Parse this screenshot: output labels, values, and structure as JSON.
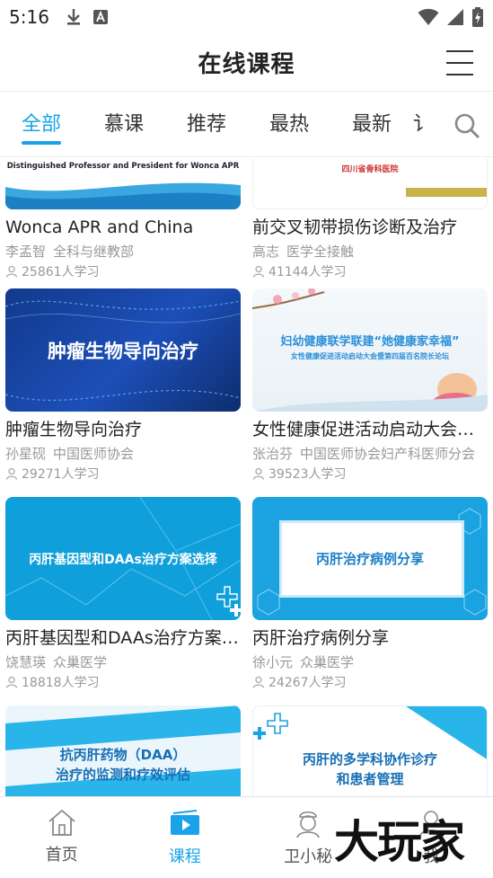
{
  "status_bar": {
    "time": "5:16"
  },
  "header": {
    "title": "在线课程"
  },
  "tabs": [
    {
      "label": "全部",
      "active": true
    },
    {
      "label": "慕课",
      "active": false
    },
    {
      "label": "推荐",
      "active": false
    },
    {
      "label": "最热",
      "active": false
    },
    {
      "label": "最新",
      "active": false
    },
    {
      "label": "讠",
      "active": false
    }
  ],
  "courses": [
    {
      "title": "Wonca APR and China",
      "teacher": "李孟智",
      "org": "全科与继教部",
      "learners": "25861人学习",
      "thumb_lines": [
        "Distinguished Professor and President for  Wonca APR"
      ]
    },
    {
      "title": "前交叉韧带损伤诊断及治疗",
      "teacher": "高志",
      "org": "医学全接触",
      "learners": "41144人学习",
      "thumb_lines": [
        "四川省骨科医院"
      ]
    },
    {
      "title": "肿瘤生物导向治疗",
      "teacher": "孙星砚",
      "org": "中国医师协会",
      "learners": "29271人学习",
      "thumb_lines": [
        "肿瘤生物导向治疗"
      ]
    },
    {
      "title": "女性健康促进活动启动大会暨第四届百名院长论坛",
      "teacher": "张治芬",
      "org": "中国医师协会妇产科医师分会",
      "learners": "39523人学习",
      "thumb_lines": [
        "妇幼健康联学联建“她健康家幸福”",
        "女性健康促进活动启动大会暨第四届百名院长论坛"
      ]
    },
    {
      "title": "丙肝基因型和DAAs治疗方案选择",
      "teacher": "饶慧瑛",
      "org": "众巢医学",
      "learners": "18818人学习",
      "thumb_lines": [
        "丙肝基因型和DAAs治疗方案选择"
      ]
    },
    {
      "title": "丙肝治疗病例分享",
      "teacher": "徐小元",
      "org": "众巢医学",
      "learners": "24267人学习",
      "thumb_lines": [
        "丙肝治疗病例分享"
      ]
    },
    {
      "title": "",
      "teacher": "",
      "org": "",
      "learners": "",
      "thumb_lines": [
        "抗丙肝药物（DAA）",
        "治疗的监测和疗效评估"
      ]
    },
    {
      "title": "",
      "teacher": "",
      "org": "",
      "learners": "",
      "thumb_lines": [
        "丙肝的多学科协作诊疗",
        "和患者管理"
      ]
    }
  ],
  "bottom_nav": [
    {
      "label": "首页",
      "icon": "home-icon"
    },
    {
      "label": "课程",
      "icon": "course-icon",
      "active": true
    },
    {
      "label": "卫小秘",
      "icon": "nurse-icon"
    },
    {
      "label": "我",
      "icon": "profile-icon"
    }
  ],
  "watermark": {
    "text": "大玩家"
  },
  "colors": {
    "accent": "#1aa3e8",
    "text": "#222222",
    "muted": "#999999"
  }
}
